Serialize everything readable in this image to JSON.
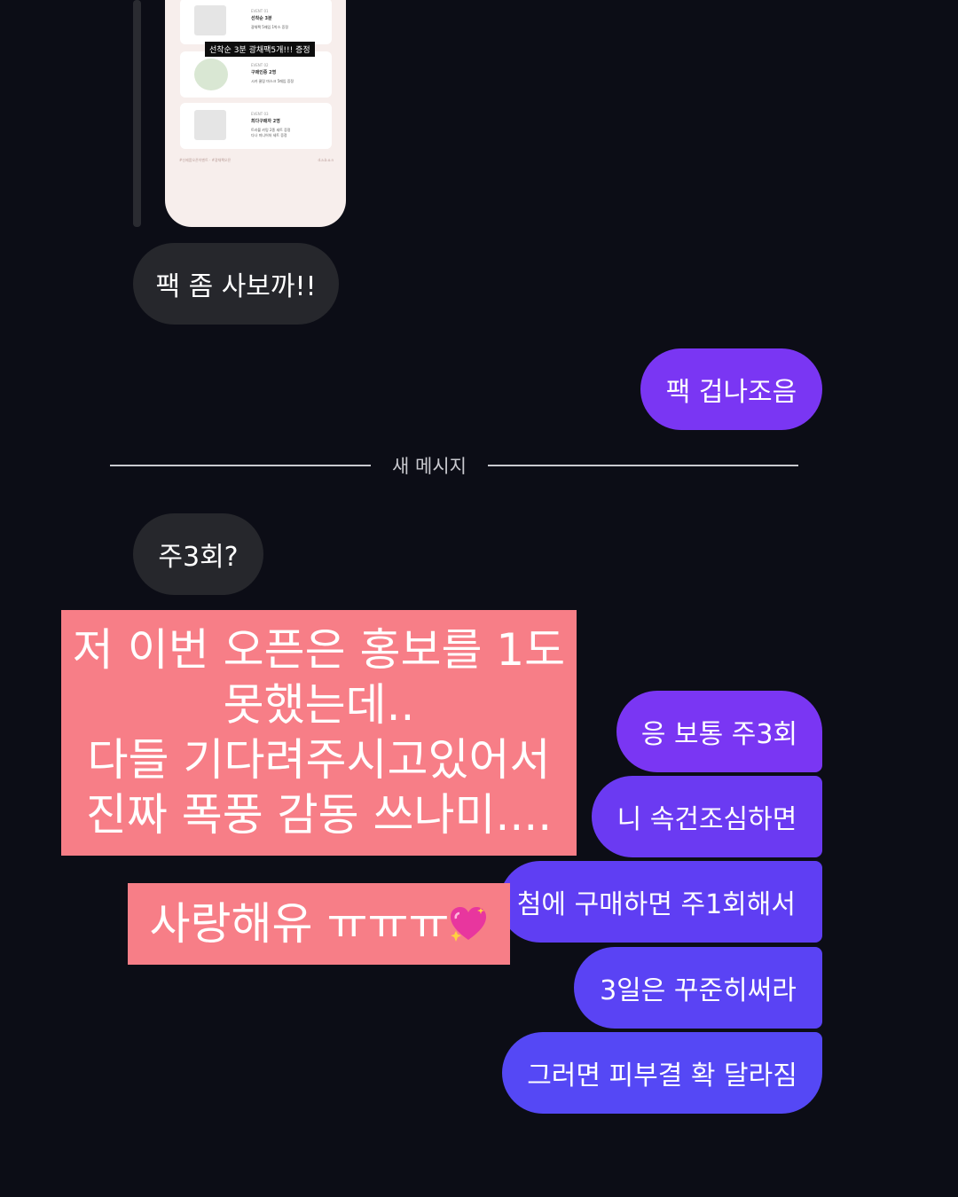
{
  "screenshot": {
    "events": [
      {
        "small": "EVENT 01",
        "title": "선착순 3분",
        "desc": "광채팩 5매입 1박스 증정"
      },
      {
        "small": "EVENT 02",
        "title": "구매인증 2명",
        "desc": "시카 쿨링 마스크 5매입 증정"
      },
      {
        "small": "EVENT 03",
        "title": "최다구매자 2명",
        "desc": "트라블 카밍 2종 세트 증정",
        "desc2": "다나 미니어처 세트 증정"
      }
    ],
    "tag": "선착순 3분 광채팩5개!!! 증정",
    "footer_left": "#신제품오픈이벤트 · #광채팩오픈",
    "footer_right": "d.a.b.o.n"
  },
  "messages": {
    "m1": "팩 좀 사보까!!",
    "m2": "팩 겁나조음",
    "divider": "새 메시지",
    "m3": "주3회?",
    "m4": "응 보통 주3회",
    "m5": "니 속건조심하면",
    "m6": "첨에 구매하면 주1회해서",
    "m7": "3일은 꾸준히써라",
    "m8": "그러면 피부결 확 달라짐"
  },
  "overlay": {
    "line1": "저 이번 오픈은 홍보를 1도",
    "line2": "못했는데..",
    "line3": "다들 기다려주시고있어서",
    "line4": "진짜 폭풍 감동 쓰나미....",
    "love": "사랑해유 ㅠㅠㅠ",
    "love_emoji": "sparkling-heart-icon"
  },
  "colors": {
    "background": "#0c0d16",
    "received_bubble": "#26272c",
    "sent_bubble_top": "#7a36f3",
    "sent_bubble_bottom": "#5548f5",
    "overlay_pink": "#f77e87"
  }
}
